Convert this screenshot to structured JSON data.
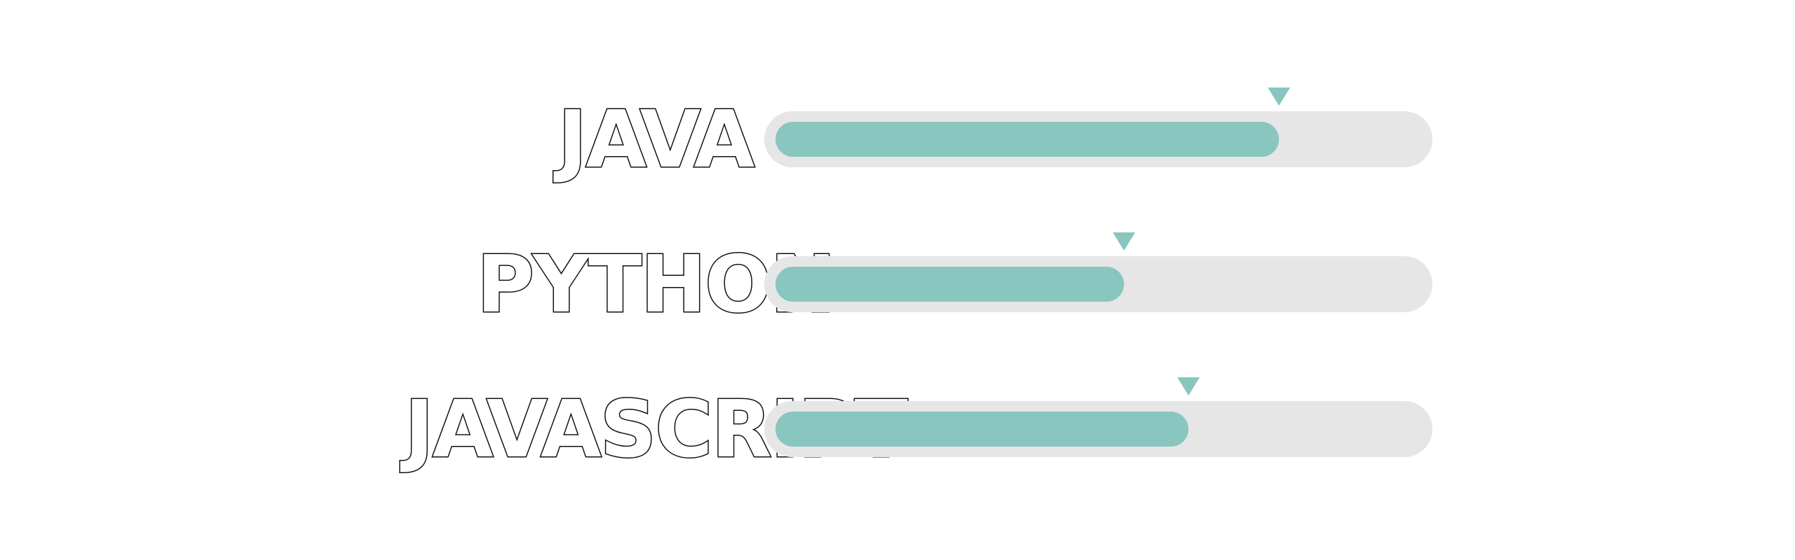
{
  "colors": {
    "accent": "#88c6bf",
    "track": "#e6e6e6",
    "background": "#ffffff",
    "label_outline": "#111111"
  },
  "skills": [
    {
      "name": "JAVA",
      "level": 0.78
    },
    {
      "name": "PYTHON",
      "level": 0.54
    },
    {
      "name": "JAVASCRIPT",
      "level": 0.64
    }
  ]
}
